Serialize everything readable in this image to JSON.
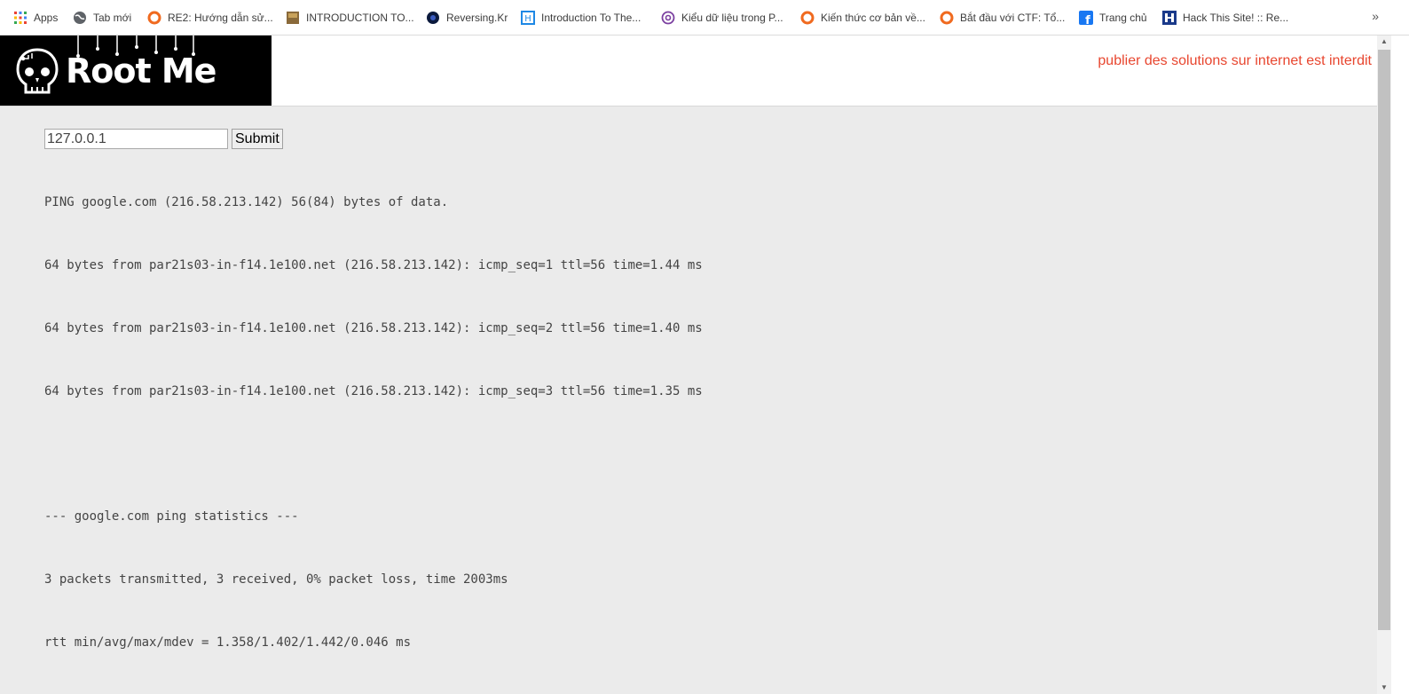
{
  "bookmarks": [
    {
      "label": "Apps",
      "icon": "apps-grid-icon"
    },
    {
      "label": "Tab mới",
      "icon": "globe-icon"
    },
    {
      "label": "RE2: Hướng dẫn sử...",
      "icon": "site-orange-icon"
    },
    {
      "label": "INTRODUCTION TO...",
      "icon": "book-thumb-icon"
    },
    {
      "label": "Reversing.Kr",
      "icon": "dark-globe-icon"
    },
    {
      "label": "Introduction To The...",
      "icon": "square-blue-icon"
    },
    {
      "label": "Kiểu dữ liệu trong P...",
      "icon": "at-sign-icon"
    },
    {
      "label": "Kiến thức cơ bản về...",
      "icon": "site-orange-icon"
    },
    {
      "label": "Bắt đầu với CTF: Tổ...",
      "icon": "site-orange-icon"
    },
    {
      "label": "Trang chủ",
      "icon": "facebook-icon"
    },
    {
      "label": "Hack This Site! :: Re...",
      "icon": "hts-icon"
    }
  ],
  "bookmarks_more": "»",
  "header": {
    "logo_text": "Root Me",
    "notice": "publier des solutions sur internet est interdit"
  },
  "form": {
    "ip_value": "127.0.0.1",
    "submit_label": "Submit"
  },
  "output_lines": [
    "PING google.com (216.58.213.142) 56(84) bytes of data.",
    "64 bytes from par21s03-in-f14.1e100.net (216.58.213.142): icmp_seq=1 ttl=56 time=1.44 ms",
    "64 bytes from par21s03-in-f14.1e100.net (216.58.213.142): icmp_seq=2 ttl=56 time=1.40 ms",
    "64 bytes from par21s03-in-f14.1e100.net (216.58.213.142): icmp_seq=3 ttl=56 time=1.35 ms",
    "",
    "--- google.com ping statistics ---",
    "3 packets transmitted, 3 received, 0% packet loss, time 2003ms",
    "rtt min/avg/max/mdev = 1.358/1.402/1.442/0.046 ms"
  ],
  "colors": {
    "notice": "#e8462f",
    "page_bg": "#ebebeb",
    "logo_bg": "#000000"
  }
}
